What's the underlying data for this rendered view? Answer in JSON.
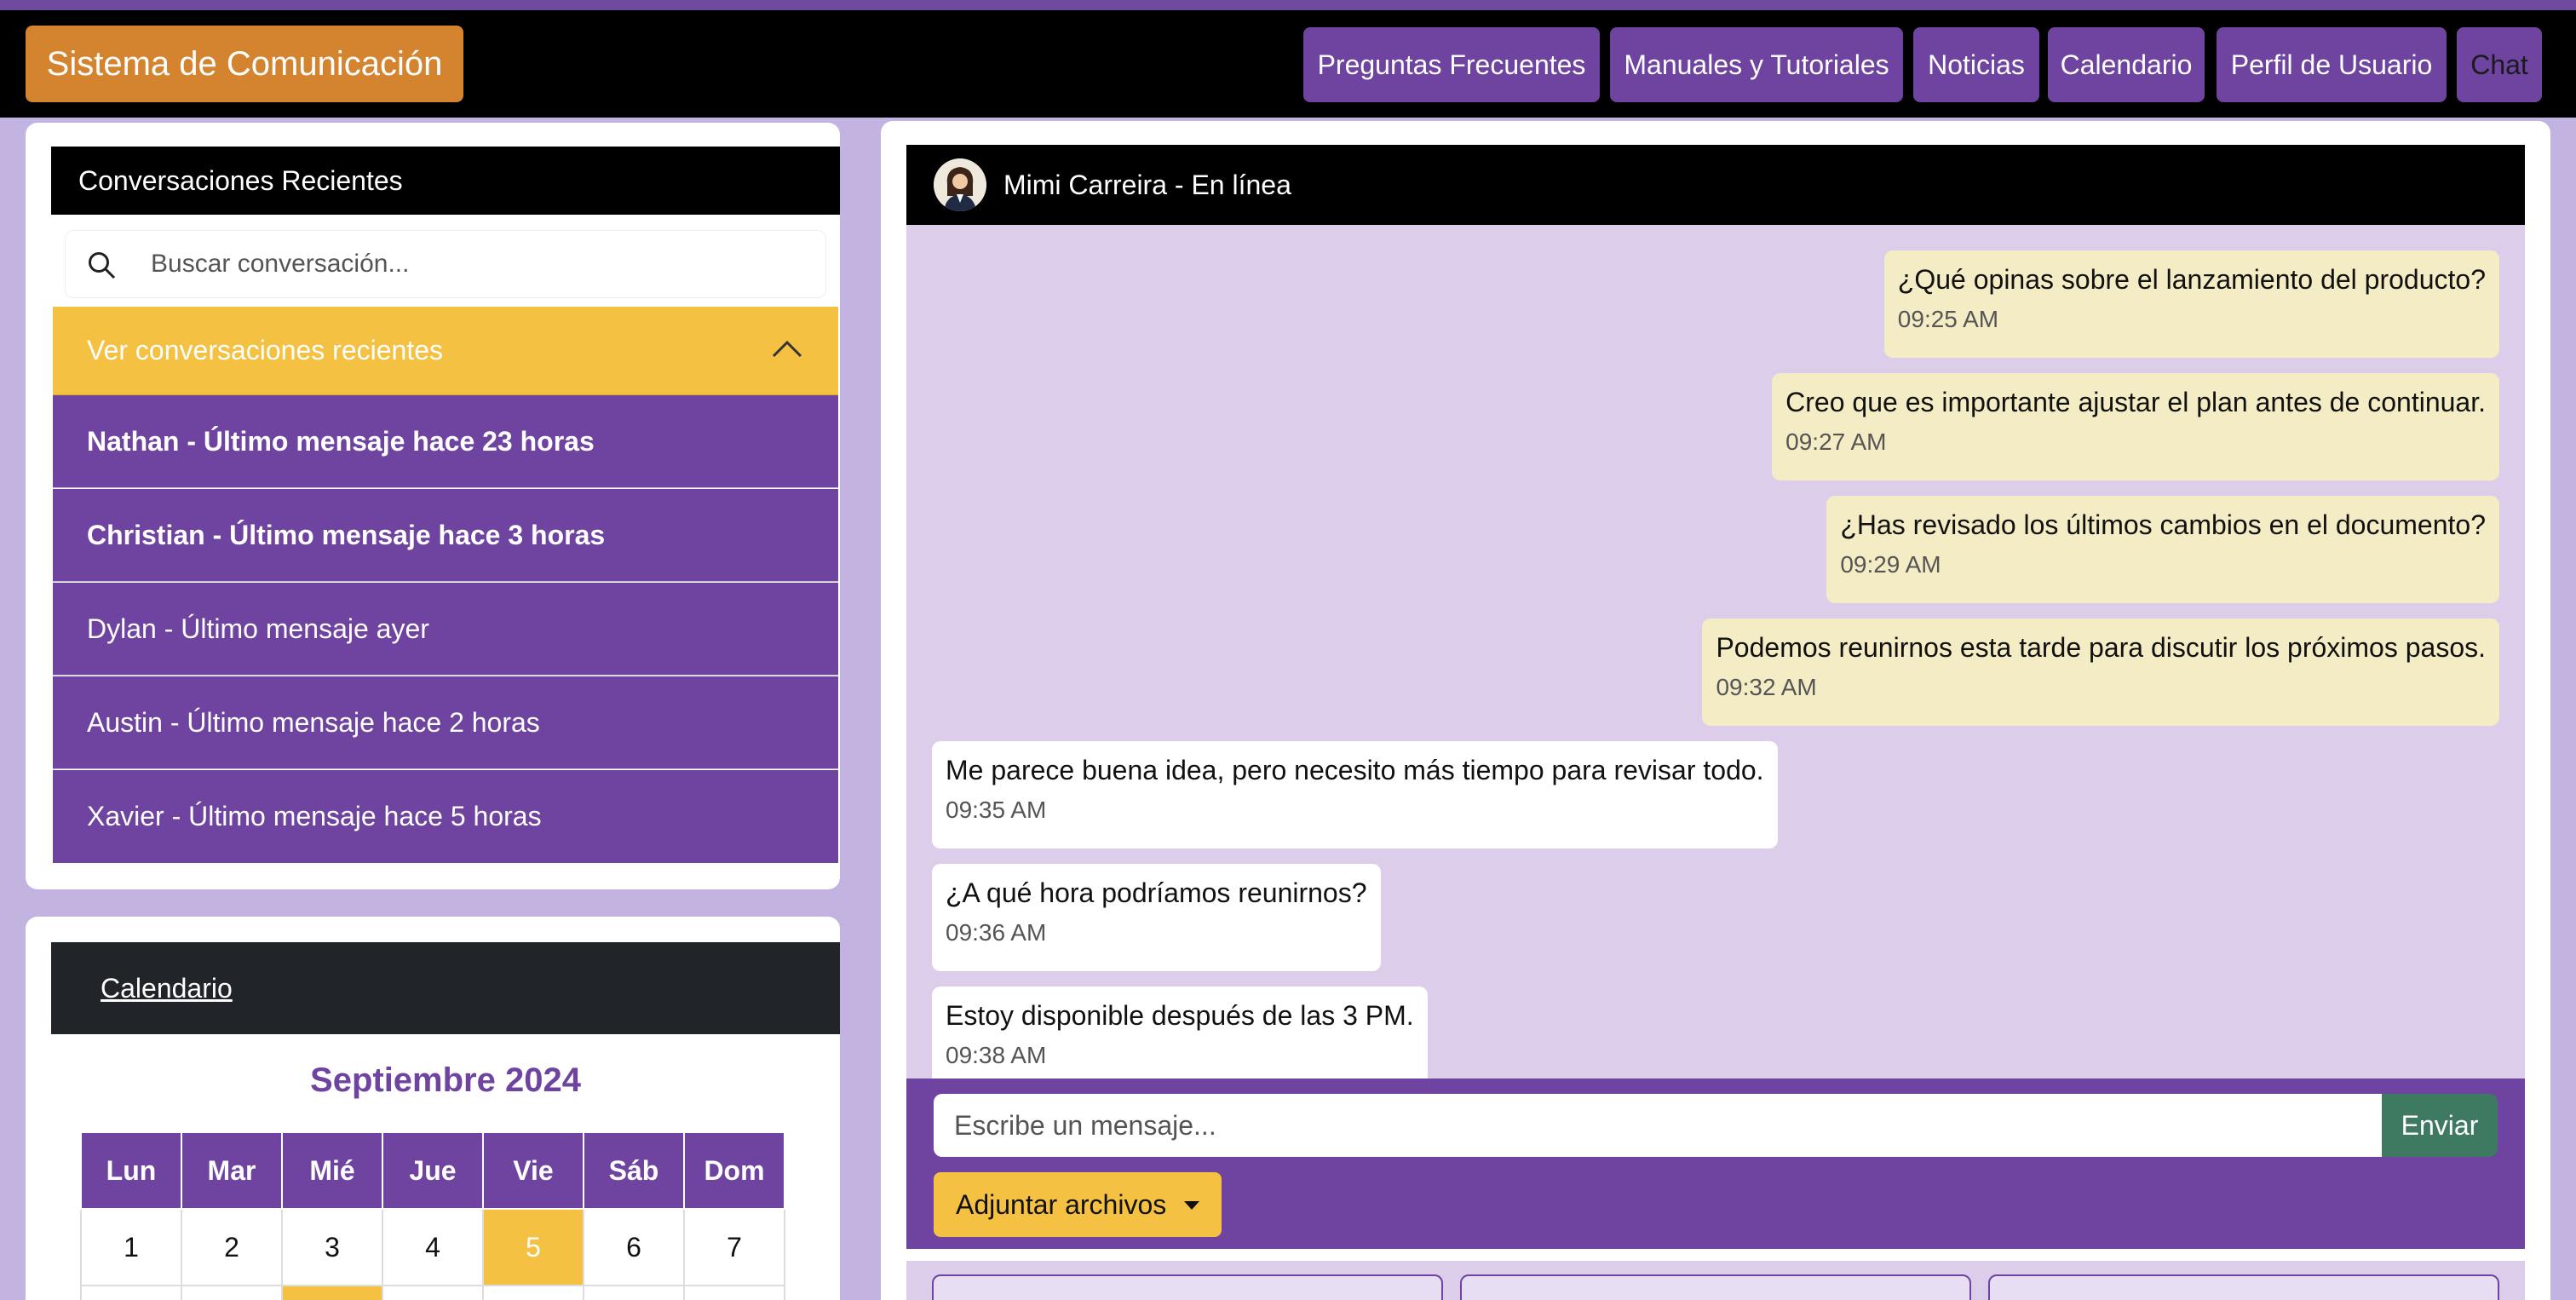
{
  "app": {
    "brand": "Sistema de Comunicación"
  },
  "nav": {
    "items": [
      "Preguntas Frecuentes",
      "Manuales y Tutoriales",
      "Noticias",
      "Calendario",
      "Perfil de Usuario",
      "Chat"
    ]
  },
  "conversations": {
    "header": "Conversaciones Recientes",
    "search_placeholder": "Buscar conversación...",
    "accordion_label": "Ver conversaciones recientes",
    "items": [
      {
        "label": "Nathan - Último mensaje hace 23 horas",
        "bold": true
      },
      {
        "label": "Christian - Último mensaje hace 3 horas",
        "bold": true
      },
      {
        "label": "Dylan - Último mensaje ayer",
        "bold": false
      },
      {
        "label": "Austin - Último mensaje hace 2 horas",
        "bold": false
      },
      {
        "label": "Xavier - Último mensaje hace 5 horas",
        "bold": false
      }
    ]
  },
  "calendar": {
    "header_link": "Calendario",
    "month_title": "Septiembre 2024",
    "weekdays": [
      "Lun",
      "Mar",
      "Mié",
      "Jue",
      "Vie",
      "Sáb",
      "Dom"
    ],
    "week1": [
      "1",
      "2",
      "3",
      "4",
      "5",
      "6",
      "7"
    ],
    "highlighted_day": "5"
  },
  "chat": {
    "header_title": "Mimi Carreira - En línea",
    "messages": [
      {
        "side": "sent",
        "text": "¿Qué opinas sobre el lanzamiento del producto?",
        "time": "09:25 AM"
      },
      {
        "side": "sent",
        "text": "Creo que es importante ajustar el plan antes de continuar.",
        "time": "09:27 AM"
      },
      {
        "side": "sent",
        "text": "¿Has revisado los últimos cambios en el documento?",
        "time": "09:29 AM"
      },
      {
        "side": "sent",
        "text": "Podemos reunirnos esta tarde para discutir los próximos pasos.",
        "time": "09:32 AM"
      },
      {
        "side": "recv",
        "text": "Me parece buena idea, pero necesito más tiempo para revisar todo.",
        "time": "09:35 AM"
      },
      {
        "side": "recv",
        "text": "¿A qué hora podríamos reunirnos?",
        "time": "09:36 AM"
      },
      {
        "side": "recv",
        "text": "Estoy disponible después de las 3 PM.",
        "time": "09:38 AM"
      }
    ],
    "input_placeholder": "Escribe un mensaje...",
    "send_label": "Enviar",
    "attach_label": "Adjuntar archivos"
  },
  "colors": {
    "background": "#c2b3e0",
    "brand": "#d4832f",
    "primary_purple": "#6e44a0",
    "accent_yellow": "#f5c142",
    "sent_bubble": "#f3ecc4",
    "chat_bg": "#dccdea",
    "send_green": "#3e7a62"
  },
  "icons": {
    "search": "search-icon",
    "accordion": "chevron-up-icon",
    "attach_caret": "caret-down-icon"
  }
}
